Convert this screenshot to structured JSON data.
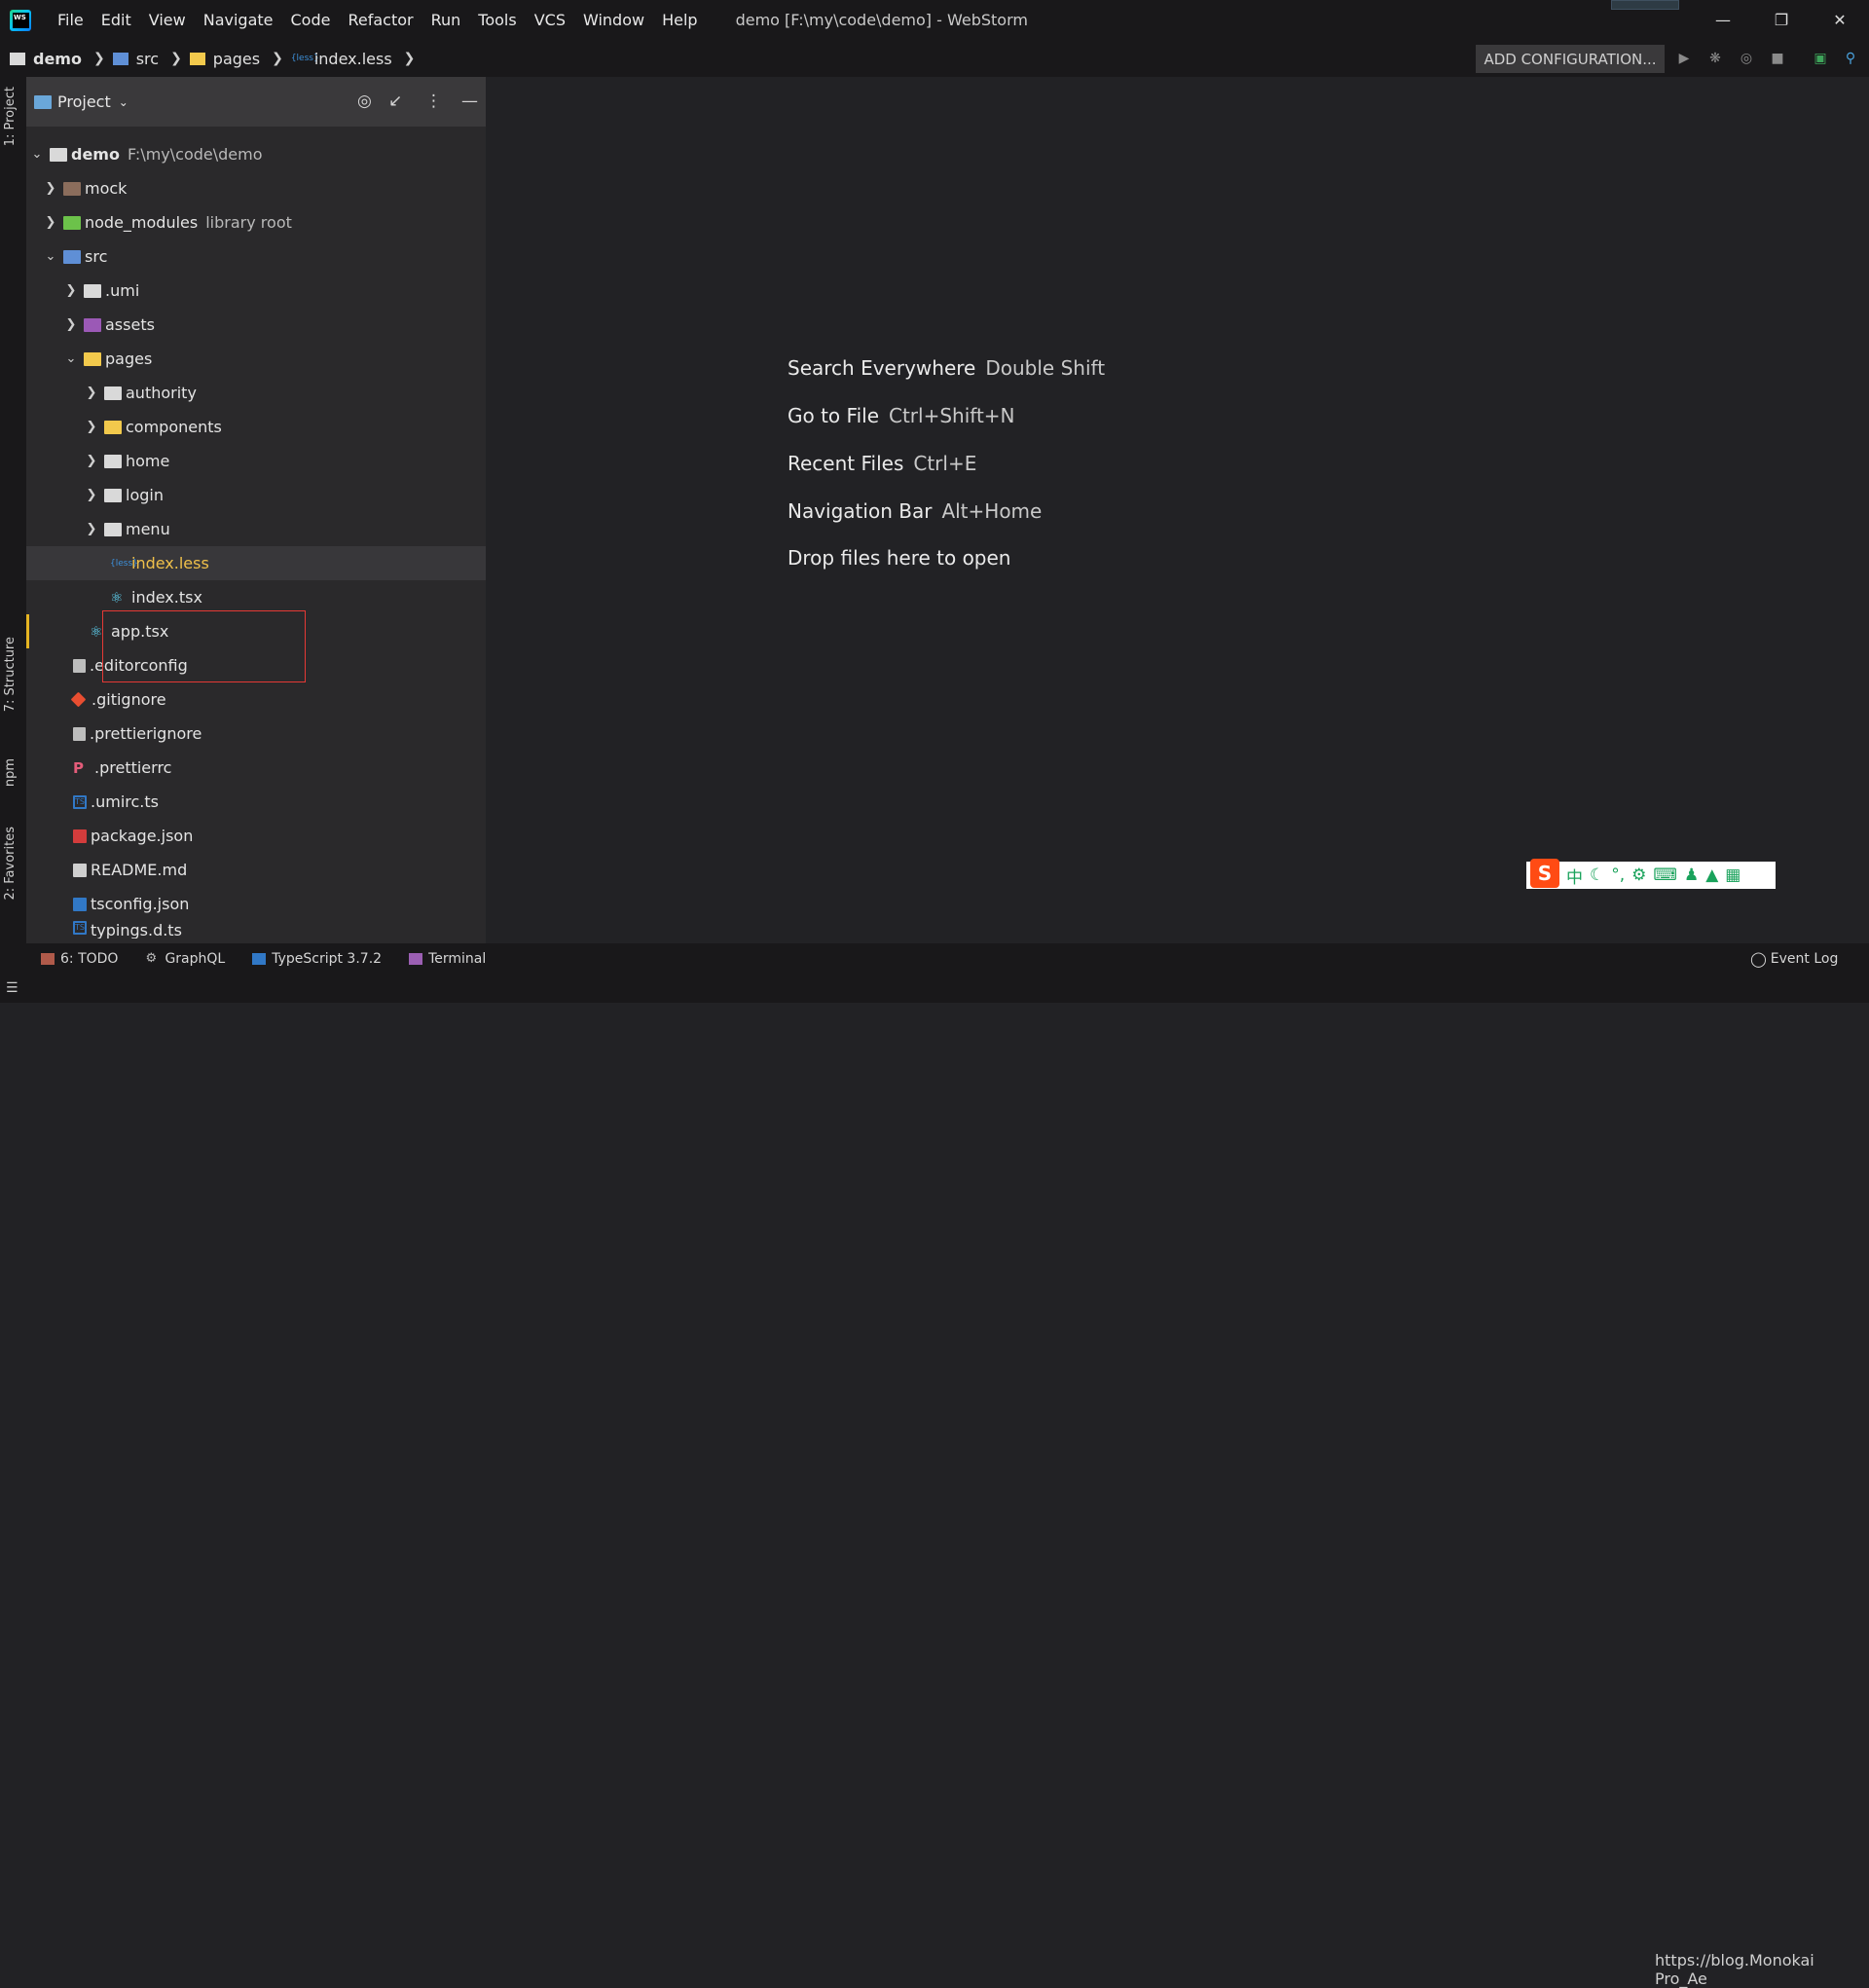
{
  "titlebar": {
    "menu": [
      "File",
      "Edit",
      "View",
      "Navigate",
      "Code",
      "Refactor",
      "Run",
      "Tools",
      "VCS",
      "Window",
      "Help"
    ],
    "window_title": "demo [F:\\my\\code\\demo] - WebStorm"
  },
  "navbar": {
    "crumbs": [
      "demo",
      "src",
      "pages",
      "index.less"
    ],
    "add_config": "ADD CONFIGURATION..."
  },
  "left_strip": {
    "project": "1: Project",
    "structure": "7: Structure",
    "npm": "npm",
    "favorites": "2: Favorites"
  },
  "panel": {
    "title": "Project"
  },
  "tree": [
    {
      "label": "demo",
      "note": "F:\\my\\code\\demo"
    },
    {
      "label": "mock"
    },
    {
      "label": "node_modules",
      "note": "library root"
    },
    {
      "label": "src"
    },
    {
      "label": ".umi"
    },
    {
      "label": "assets"
    },
    {
      "label": "pages"
    },
    {
      "label": "authority"
    },
    {
      "label": "components"
    },
    {
      "label": "home"
    },
    {
      "label": "login"
    },
    {
      "label": "menu"
    },
    {
      "label": "index.less"
    },
    {
      "label": "index.tsx"
    },
    {
      "label": "app.tsx"
    },
    {
      "label": ".editorconfig"
    },
    {
      "label": ".gitignore"
    },
    {
      "label": ".prettierignore"
    },
    {
      "label": ".prettierrc"
    },
    {
      "label": ".umirc.ts"
    },
    {
      "label": "package.json"
    },
    {
      "label": "README.md"
    },
    {
      "label": "tsconfig.json"
    },
    {
      "label": "typings.d.ts"
    }
  ],
  "editor_hints": [
    {
      "label": "Search Everywhere",
      "key": "Double Shift"
    },
    {
      "label": "Go to File",
      "key": "Ctrl+Shift+N"
    },
    {
      "label": "Recent Files",
      "key": "Ctrl+E"
    },
    {
      "label": "Navigation Bar",
      "key": "Alt+Home"
    },
    {
      "label": "Drop files here to open",
      "key": ""
    }
  ],
  "bottom_tools": {
    "todo": "6: TODO",
    "graphql": "GraphQL",
    "typescript": "TypeScript 3.7.2",
    "terminal": "Terminal",
    "event_log": "Event Log"
  },
  "ime": {
    "logo": "S",
    "chinese": "中"
  },
  "watermark": "https://blog.Monokai Pro_Ae"
}
